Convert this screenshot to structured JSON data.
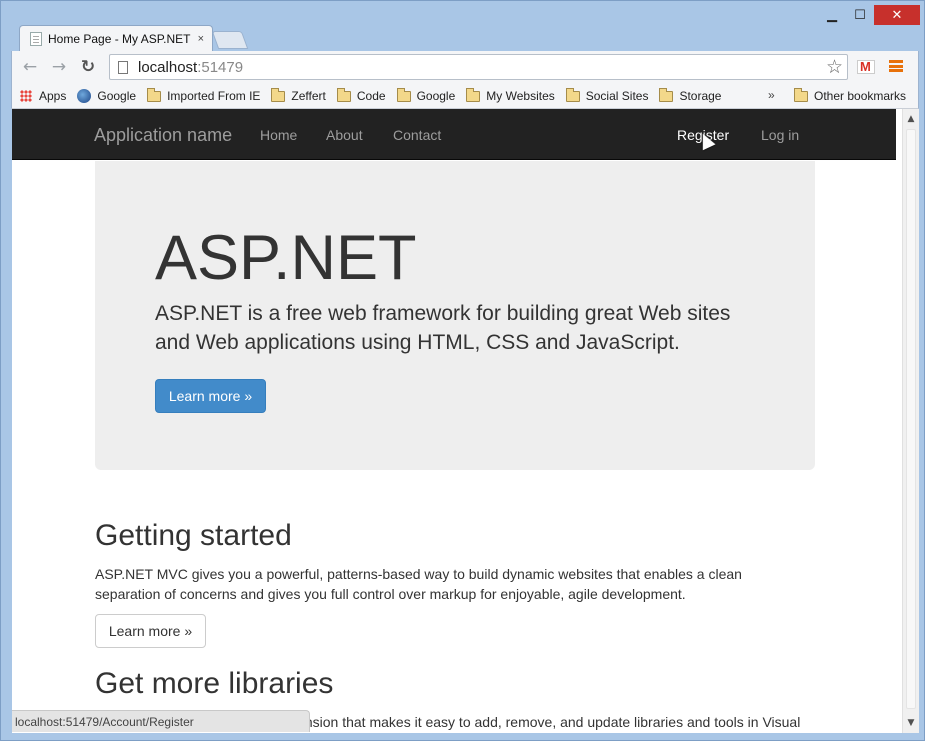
{
  "window": {
    "minimize": "▁",
    "maximize": "☐",
    "close": "✕"
  },
  "tab": {
    "title": "Home Page - My ASP.NET",
    "close": "×"
  },
  "toolbar": {
    "back": "←",
    "forward": "→",
    "reload": "↻",
    "url_host": "localhost",
    "url_port": ":51479",
    "star": "☆"
  },
  "bookmarks": {
    "items": [
      "Apps",
      "Google",
      "Imported From IE",
      "Zeffert",
      "Code",
      "Google",
      "My Websites",
      "Social Sites",
      "Storage"
    ],
    "overflow": "»",
    "other": "Other bookmarks"
  },
  "site": {
    "brand": "Application name",
    "nav": [
      "Home",
      "About",
      "Contact"
    ],
    "register": "Register",
    "login": "Log in"
  },
  "jumbotron": {
    "title": "ASP.NET",
    "lead": "ASP.NET is a free web framework for building great Web sites and Web applications using HTML, CSS and JavaScript.",
    "button": "Learn more »"
  },
  "sections": [
    {
      "title": "Getting started",
      "text": "ASP.NET MVC gives you a powerful, patterns-based way to build dynamic websites that enables a clean separation of concerns and gives you full control over markup for enjoyable, agile development.",
      "button": "Learn more »"
    },
    {
      "title": "Get more libraries",
      "text": "NuGet is a free Visual Studio extension that makes it easy to add, remove, and update libraries and tools in Visual"
    }
  ],
  "status": {
    "url": "localhost:51479/Account/Register"
  }
}
